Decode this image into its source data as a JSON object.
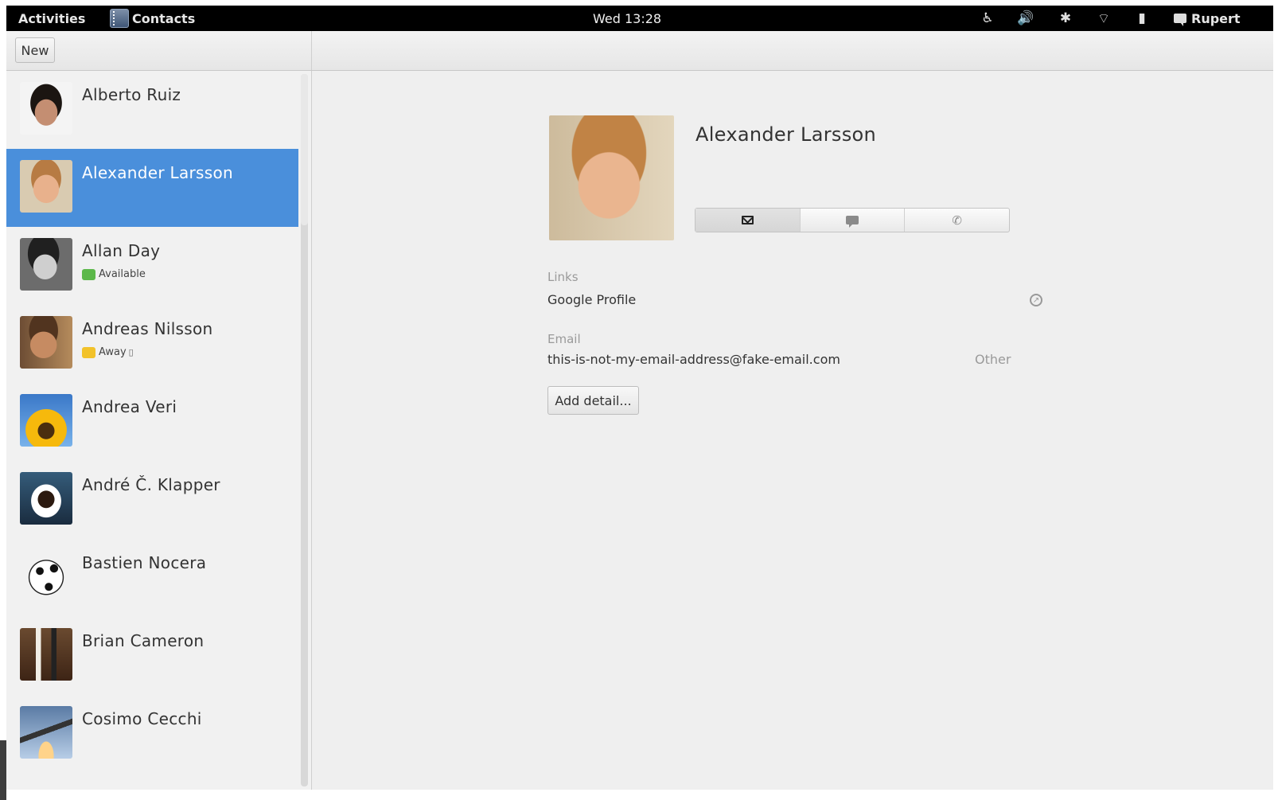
{
  "topbar": {
    "activities": "Activities",
    "app_name": "Contacts",
    "clock": "Wed 13:28",
    "user": "Rupert",
    "status_icons": [
      "accessibility-icon",
      "volume-icon",
      "bluetooth-icon",
      "wifi-icon",
      "battery-icon"
    ]
  },
  "toolbar": {
    "new_label": "New"
  },
  "contacts": [
    {
      "name": "Alberto Ruiz",
      "status": ""
    },
    {
      "name": "Alexander Larsson",
      "status": "",
      "selected": true
    },
    {
      "name": "Allan Day",
      "status": "Available"
    },
    {
      "name": "Andreas Nilsson",
      "status": "Away"
    },
    {
      "name": "Andrea Veri",
      "status": ""
    },
    {
      "name": "André Č. Klapper",
      "status": ""
    },
    {
      "name": "Bastien Nocera",
      "status": ""
    },
    {
      "name": "Brian Cameron",
      "status": ""
    },
    {
      "name": "Cosimo Cecchi",
      "status": ""
    }
  ],
  "detail": {
    "name": "Alexander Larsson",
    "actions": [
      "email-icon",
      "chat-icon",
      "phone-icon"
    ],
    "links_label": "Links",
    "link_value": "Google Profile",
    "email_label": "Email",
    "email_value": "this-is-not-my-email-address@fake-email.com",
    "email_type": "Other",
    "add_detail": "Add detail..."
  },
  "colors": {
    "selected": "#4a8fdb",
    "topbar": "#000000"
  }
}
